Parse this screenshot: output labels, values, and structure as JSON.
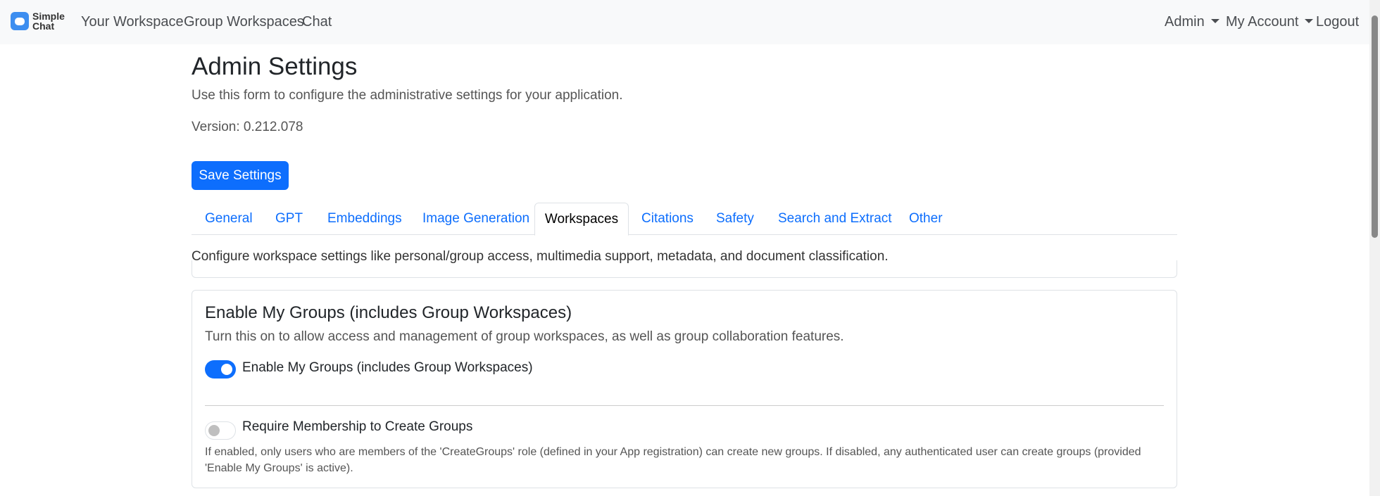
{
  "nav": {
    "logo_line1": "Simple",
    "logo_line2": "Chat",
    "links": [
      "Your Workspace",
      "Group Workspaces",
      "Chat"
    ],
    "admin": "Admin",
    "account": "My Account",
    "logout": "Logout"
  },
  "page": {
    "title": "Admin Settings",
    "subtitle": "Use this form to configure the administrative settings for your application.",
    "version": "Version: 0.212.078",
    "save": "Save Settings"
  },
  "tabs": [
    "General",
    "GPT",
    "Embeddings",
    "Image Generation",
    "Workspaces",
    "Citations",
    "Safety",
    "Search and Extract",
    "Other"
  ],
  "active_tab": "Workspaces",
  "workspaces": {
    "description": "Configure workspace settings like personal/group access, multimedia support, metadata, and document classification.",
    "section_title": "Enable My Groups (includes Group Workspaces)",
    "section_desc": "Turn this on to allow access and management of group workspaces, as well as group collaboration features.",
    "toggle1_label": "Enable My Groups (includes Group Workspaces)",
    "toggle1_on": true,
    "toggle2_label": "Require Membership to Create Groups",
    "toggle2_on": false,
    "toggle2_help": "If enabled, only users who are members of the 'CreateGroups' role (defined in your App registration) can create new groups. If disabled, any authenticated user can create groups (provided 'Enable My Groups' is active)."
  }
}
